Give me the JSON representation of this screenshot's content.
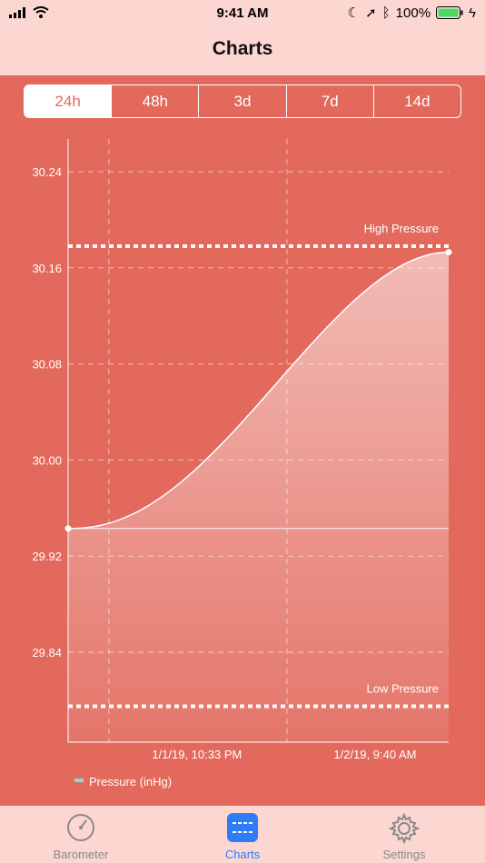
{
  "status": {
    "time": "9:41 AM",
    "battery": "100%"
  },
  "nav": {
    "title": "Charts"
  },
  "segments": [
    "24h",
    "48h",
    "3d",
    "7d",
    "14d"
  ],
  "selected_segment": "24h",
  "chart_data": {
    "type": "area",
    "ylim": [
      29.79,
      30.27
    ],
    "yticks": [
      "30.24",
      "30.16",
      "30.08",
      "30.00",
      "29.92",
      "29.84"
    ],
    "xtick_labels": [
      "1/1/19, 10:33 PM",
      "1/2/19, 9:40 AM"
    ],
    "series": [
      {
        "name": "Pressure (inHg)",
        "color": "#8ed4ef",
        "start": 29.943,
        "end": 30.173
      }
    ],
    "baseline": 29.943,
    "thresholds": [
      {
        "label": "High Pressure",
        "value": 30.178
      },
      {
        "label": "Low Pressure",
        "value": 29.795
      }
    ]
  },
  "tabs": [
    {
      "label": "Barometer",
      "icon": "gauge-icon",
      "active": false
    },
    {
      "label": "Charts",
      "icon": "chart-icon",
      "active": true
    },
    {
      "label": "Settings",
      "icon": "gear-icon",
      "active": false
    }
  ],
  "colors": {
    "background": "#e2695c",
    "bars": "#fcd6d0",
    "accent": "#2f7df6"
  }
}
